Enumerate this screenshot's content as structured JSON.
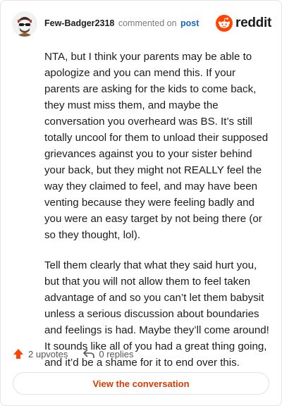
{
  "header": {
    "username": "Few-Badger2318",
    "action_text": "commented on",
    "post_link": "post",
    "logo_text": "reddit"
  },
  "comment": {
    "paragraphs": [
      "NTA, but I think your parents may be able to apologize and you can mend this. If your parents are asking for the kids to come back, they must miss them, and maybe the conversation you overheard was BS. It’s still totally uncool for them to unload their supposed grievances against you to your sister behind your back, but they might not REALLY feel the way they claimed to feel, and may have been venting because they were feeling badly and you were an easy target by not being there (or so they thought, lol).",
      "Tell them clearly that what they said hurt you, but that you will not allow them to feel taken advantage of and so you can’t let them babysit unless a serious discussion about boundaries and feelings is had. Maybe they’ll come around! It sounds like all of you had a great thing going, and it’d be a shame for it to end over this."
    ]
  },
  "footer": {
    "upvotes": "2 upvotes",
    "replies": "0 replies",
    "view_button": "View the conversation"
  },
  "colors": {
    "accent": "#d93a00",
    "link": "#1a63c7",
    "upvote": "#ff4500"
  },
  "icons": {
    "avatar": "snoo-avatar",
    "logo": "reddit-logo",
    "upvote": "upvote-arrow-icon",
    "reply": "reply-arrow-icon"
  }
}
